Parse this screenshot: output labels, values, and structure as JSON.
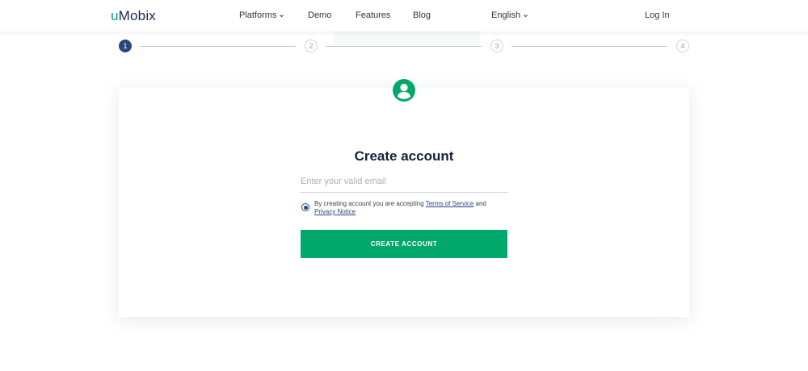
{
  "header": {
    "logo_u": "u",
    "logo_rest": "Mobix",
    "nav": {
      "platforms": "Platforms",
      "demo": "Demo",
      "features": "Features",
      "blog": "Blog",
      "language": "English",
      "login": "Log In"
    }
  },
  "stepper": {
    "steps": [
      "1",
      "2",
      "3",
      "4"
    ],
    "active_step": 1
  },
  "form": {
    "title": "Create account",
    "email_placeholder": "Enter your valid email",
    "consent_prefix": "By creating account you are accepting ",
    "terms_link": "Terms of Service",
    "consent_and": " and",
    "privacy_link": "Privacy Notice",
    "submit_label": "CREATE ACCOUNT"
  },
  "colors": {
    "brand_green": "#00a96b",
    "brand_navy": "#29467a"
  }
}
